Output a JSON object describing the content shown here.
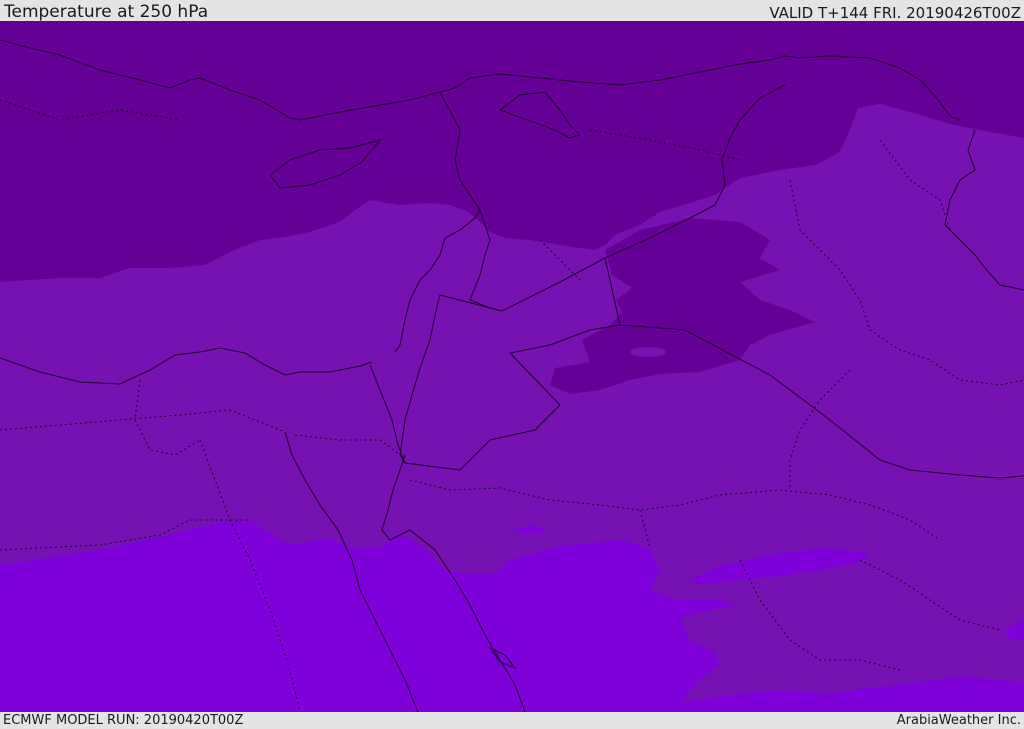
{
  "header": {
    "title": "Temperature at 250 hPa",
    "valid": "VALID T+144 FRI. 20190426T00Z"
  },
  "footer": {
    "model_run": "ECMWF MODEL RUN: 20190420T00Z",
    "credit": "ArabiaWeather Inc."
  },
  "map": {
    "variable": "temperature",
    "level": "250 hPa",
    "colors": {
      "coldest": "#650096",
      "mid": "#7612b2",
      "warmest": "#7f00db",
      "coastline": "#1a0028"
    }
  }
}
